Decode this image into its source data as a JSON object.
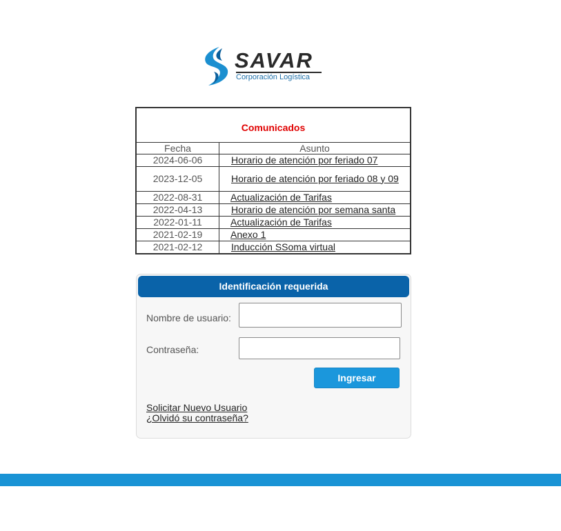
{
  "logo": {
    "name": "SAVAR",
    "tagline": "Corporación Logística"
  },
  "comunicados": {
    "title": "Comunicados",
    "headers": {
      "date": "Fecha",
      "subject": "Asunto"
    },
    "rows": [
      {
        "date": "2024-06-06",
        "subject": "Horario de atención por feriado 07"
      },
      {
        "date": "2023-12-05",
        "subject": "Horario de atención por feriado 08 y 09"
      },
      {
        "date": "2022-08-31",
        "subject": "Actualización de Tarifas"
      },
      {
        "date": "2022-04-13",
        "subject": "Horario de atención por semana santa"
      },
      {
        "date": "2022-01-11",
        "subject": "Actualización de Tarifas"
      },
      {
        "date": "2021-02-19",
        "subject": "Anexo 1"
      },
      {
        "date": "2021-02-12",
        "subject": "Inducción SSoma virtual"
      }
    ]
  },
  "login": {
    "header": "Identificación requerida",
    "username_label": "Nombre de usuario:",
    "username_value": "",
    "password_label": "Contraseña:",
    "password_value": "",
    "submit_label": "Ingresar",
    "new_user_link": "Solicitar Nuevo Usuario",
    "forgot_link": "¿Olvidó su contraseña?"
  },
  "colors": {
    "title_red": "#e00000",
    "header_blue": "#0a63a9",
    "button_blue": "#1b97dc",
    "footer_blue": "#1a93d5",
    "logo_blue": "#1d6fa8"
  }
}
